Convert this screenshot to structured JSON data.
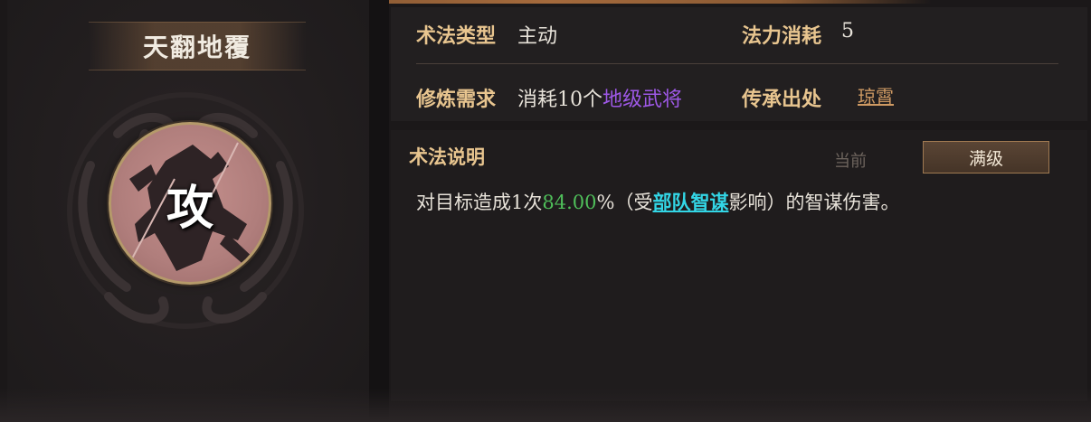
{
  "skill": {
    "name": "天翻地覆",
    "icon_char": "攻",
    "icon": "warrior-silhouette-icon"
  },
  "info": {
    "type_label": "术法类型",
    "type_value": "主动",
    "cost_label": "法力消耗",
    "cost_value": "5",
    "train_label": "修炼需求",
    "train_prefix": "消耗10个",
    "train_highlight": "地级武将",
    "source_label": "传承出处",
    "source_value": "琼霄"
  },
  "description": {
    "title": "术法说明",
    "tab_current": "当前",
    "tab_max": "满级",
    "text_prefix": "对目标造成1次",
    "percent": "84.00",
    "text_mid": "%（受",
    "keyword": "部队智谋",
    "text_suffix": "影响）的智谋伤害。"
  },
  "colors": {
    "label_gold": "#e8c58f",
    "purple": "#9e58e6",
    "green": "#4fbf5a",
    "cyan": "#33d6e6"
  }
}
